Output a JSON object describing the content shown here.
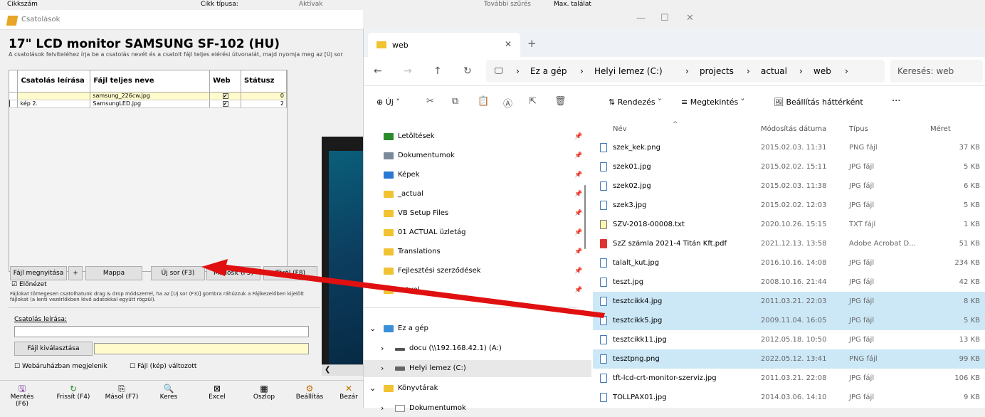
{
  "background_bar": {
    "cikkszam": "Cikkszám",
    "cikk_tipusa": "Cikk típusa:",
    "aktivak": "Aktívak",
    "tovabbi": "További szűrés",
    "max": "Max. találat"
  },
  "left_window": {
    "title": "Csatolások",
    "heading": "17\" LCD monitor SAMSUNG SF-102 (HU)",
    "subheading": "A csatolások felviteléhez írja be a csatolás nevét és a csatolt fájl teljes elérési útvonalát, majd nyomja meg az [Új sor",
    "table": {
      "headers": [
        "Csatolás leírása",
        "Fájl teljes neve",
        "Web",
        "Státusz"
      ],
      "rows": [
        {
          "leiras": "",
          "fajl": "samsung_226cw.jpg",
          "web": "✔",
          "status": "0"
        },
        {
          "leiras": "kép 2.",
          "fajl": "SamsungLED.jpg",
          "web": "✔",
          "status": "2"
        }
      ]
    },
    "buttons": {
      "open": "Fájl megnyitása",
      "plus": "+",
      "folder": "Mappa",
      "new_row": "Új sor (F3)",
      "modify": "Módosít (F5)",
      "delete": "Töröl (F8)"
    },
    "preview_label": "Előnézet",
    "hint": "Fájlokat tömegesen csatolhatunk drag & drop módszerrel, ha az [Új sor (F3)] gombra ráhúzzuk a Fájlkezelőben kijelölt fájlokat (a lenti vezérlőkben lévő adatokkal együtt rögzül).",
    "desc_label": "Csatolás leírása:",
    "select_file": "Fájl kiválasztása",
    "web_check": "Webáruházban megjelenik",
    "changed_check": "Fájl (kép) változott",
    "bottom": [
      {
        "icon": "🖫",
        "label": "Mentés (F6)"
      },
      {
        "icon": "↻",
        "label": "Frissít (F4)"
      },
      {
        "icon": "⎘",
        "label": "Másol (F7)"
      },
      {
        "icon": "🔍",
        "label": "Keres"
      },
      {
        "icon": "⊠",
        "label": "Excel"
      },
      {
        "icon": "▦",
        "label": "Oszlop"
      },
      {
        "icon": "⚙",
        "label": "Beállítás"
      },
      {
        "icon": "✕",
        "label": "Bezár"
      }
    ]
  },
  "explorer": {
    "tab": "web",
    "breadcrumb": [
      "Ez a gép",
      "Helyi lemez (C:)",
      "projects",
      "actual",
      "web"
    ],
    "search": "Keresés: web",
    "cmd": {
      "new": "Új",
      "sort": "Rendezés",
      "view": "Megtekintés",
      "bg": "Beállítás háttérként",
      "more": "···"
    },
    "nav": [
      {
        "label": "Letöltések",
        "color": "#2a8c2a"
      },
      {
        "label": "Dokumentumok",
        "color": "#7b8a9a"
      },
      {
        "label": "Képek",
        "color": "#2b78d4"
      },
      {
        "label": "_actual",
        "color": "#f1c232"
      },
      {
        "label": "VB Setup Files",
        "color": "#f1c232"
      },
      {
        "label": "01 ACTUAL üzletág",
        "color": "#f1c232"
      },
      {
        "label": "Translations",
        "color": "#f1c232"
      },
      {
        "label": "Fejlesztési szerződések",
        "color": "#f1c232"
      },
      {
        "label": "actual",
        "color": "#f1c232"
      }
    ],
    "tree": [
      {
        "label": "Ez a gép",
        "arrow": "⌄"
      },
      {
        "label": "docu (\\\\192.168.42.1) (A:)",
        "arrow": "›"
      },
      {
        "label": "Helyi lemez (C:)",
        "arrow": "›"
      },
      {
        "label": "Könyvtárak",
        "arrow": "⌄"
      },
      {
        "label": "Dokumentumok",
        "arrow": "›"
      }
    ],
    "columns": [
      "Név",
      "Módosítás dátuma",
      "Típus",
      "Méret"
    ],
    "files": [
      {
        "name": "szek_kek.png",
        "date": "2015.02.03. 11:31",
        "type": "PNG fájl",
        "size": "37 KB"
      },
      {
        "name": "szek01.jpg",
        "date": "2015.02.02. 15:11",
        "type": "JPG fájl",
        "size": "5 KB"
      },
      {
        "name": "szek02.jpg",
        "date": "2015.02.03. 11:38",
        "type": "JPG fájl",
        "size": "6 KB"
      },
      {
        "name": "szek3.jpg",
        "date": "2015.02.02. 12:03",
        "type": "JPG fájl",
        "size": "5 KB"
      },
      {
        "name": "SZV-2018-00008.txt",
        "date": "2020.10.26. 15:15",
        "type": "TXT fájl",
        "size": "1 KB"
      },
      {
        "name": "SzZ számla 2021-4 Titán Kft.pdf",
        "date": "2021.12.13. 13:58",
        "type": "Adobe Acrobat D...",
        "size": "51 KB"
      },
      {
        "name": "talalt_kut.jpg",
        "date": "2016.10.16. 14:08",
        "type": "JPG fájl",
        "size": "234 KB"
      },
      {
        "name": "teszt.jpg",
        "date": "2008.10.16. 21:44",
        "type": "JPG fájl",
        "size": "42 KB"
      },
      {
        "name": "tesztcikk4.jpg",
        "date": "2011.03.21. 22:03",
        "type": "JPG fájl",
        "size": "8 KB",
        "sel": true
      },
      {
        "name": "tesztcikk5.jpg",
        "date": "2009.11.04. 16:05",
        "type": "JPG fájl",
        "size": "5 KB",
        "sel": true
      },
      {
        "name": "tesztcikk11.jpg",
        "date": "2012.05.18. 10:50",
        "type": "JPG fájl",
        "size": "13 KB"
      },
      {
        "name": "tesztpng.png",
        "date": "2022.05.12. 13:41",
        "type": "PNG fájl",
        "size": "99 KB",
        "sel": true
      },
      {
        "name": "tft-lcd-crt-monitor-szerviz.jpg",
        "date": "2011.03.21. 22:08",
        "type": "JPG fájl",
        "size": "106 KB"
      },
      {
        "name": "TOLLPAX01.jpg",
        "date": "2014.03.06. 14:10",
        "type": "JPG fájl",
        "size": "9 KB"
      }
    ]
  },
  "arrow_color": "#e01010"
}
